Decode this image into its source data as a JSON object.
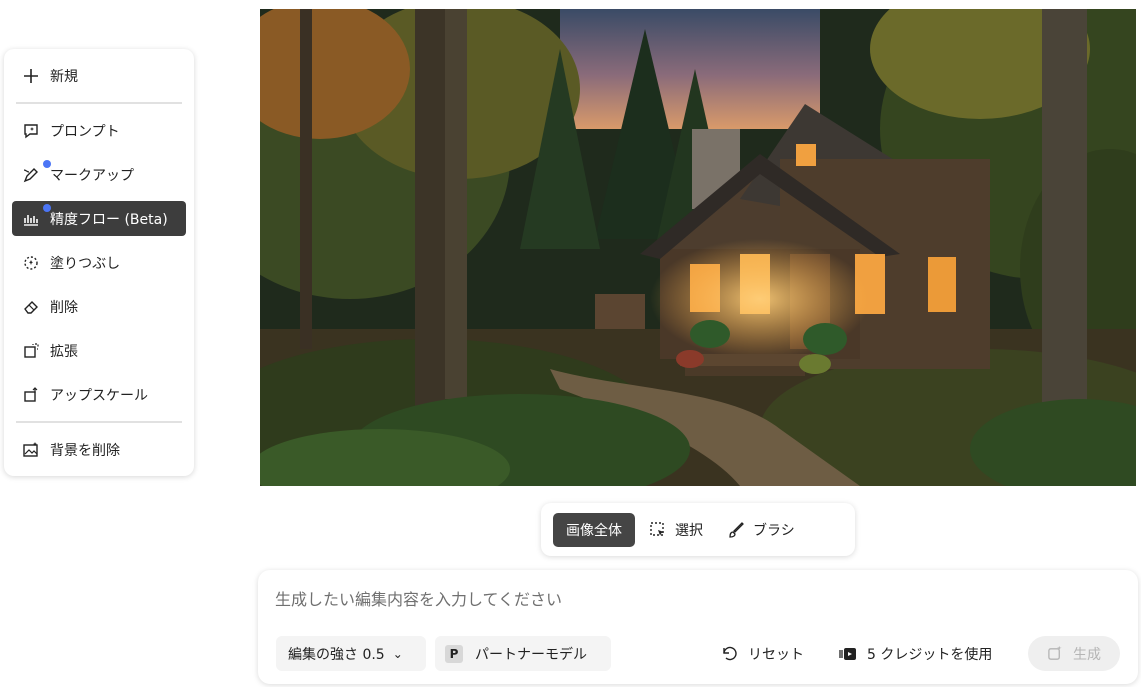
{
  "sidebar": {
    "items": [
      {
        "label": "新規",
        "icon": "plus-icon"
      },
      {
        "label": "プロンプト",
        "icon": "prompt-icon"
      },
      {
        "label": "マークアップ",
        "icon": "markup-pen-icon"
      },
      {
        "label": "精度フロー (Beta)",
        "icon": "precision-flow-icon"
      },
      {
        "label": "塗りつぶし",
        "icon": "fill-icon"
      },
      {
        "label": "削除",
        "icon": "eraser-icon"
      },
      {
        "label": "拡張",
        "icon": "expand-icon"
      },
      {
        "label": "アップスケール",
        "icon": "upscale-icon"
      },
      {
        "label": "背景を削除",
        "icon": "remove-background-icon"
      }
    ],
    "active_item": "精度フロー (Beta)",
    "accent_dot_color": "#4b75f5"
  },
  "scope": {
    "whole_image": "画像全体",
    "selection": "選択",
    "brush": "ブラシ"
  },
  "prompt": {
    "placeholder": "生成したい編集内容を入力してください",
    "value": "",
    "strength_label": "編集の強さ 0.5",
    "partner_badge": "P",
    "partner_label": "パートナーモデル",
    "reset_label": "リセット",
    "credits_label": "5 クレジットを使用",
    "generate_label": "生成"
  },
  "colors": {
    "active_bg": "#3d3d3d",
    "disabled_text": "#b5b5b5"
  }
}
